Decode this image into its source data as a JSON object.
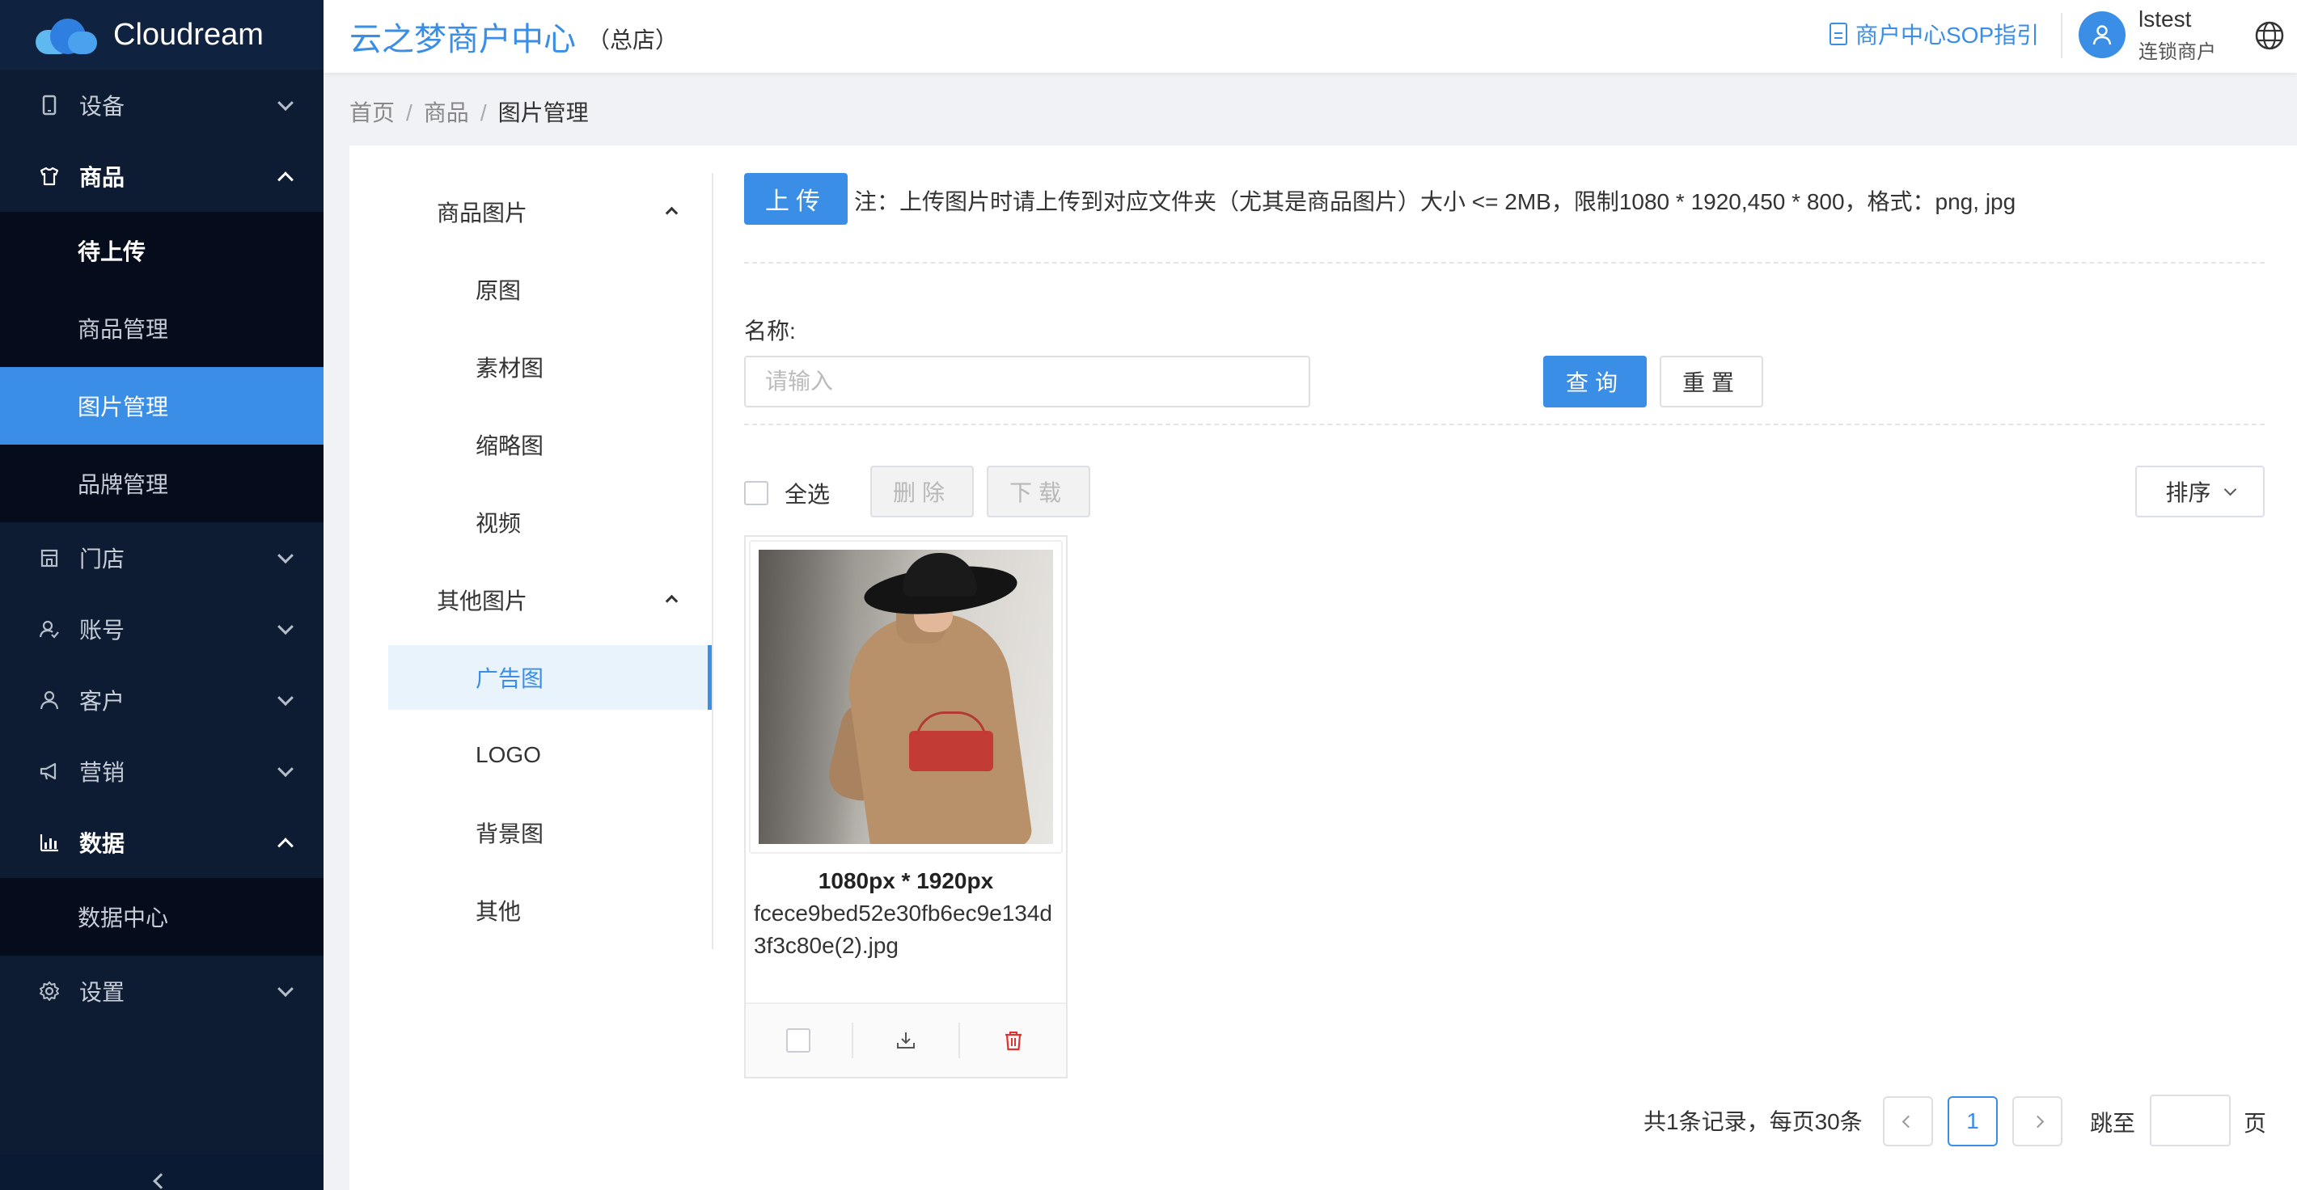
{
  "sidebar": {
    "brand": "Cloudream",
    "menu": {
      "devices": "设备",
      "goods": "商品",
      "goods_sub": [
        "待上传",
        "商品管理",
        "图片管理",
        "品牌管理"
      ],
      "stores": "门店",
      "accounts": "账号",
      "customers": "客户",
      "marketing": "营销",
      "data": "数据",
      "data_sub": [
        "数据中心"
      ],
      "settings": "设置"
    }
  },
  "header": {
    "title": "云之梦商户中心",
    "subtitle": "（总店）",
    "sop_link": "商户中心SOP指引",
    "user_name": "lstest",
    "user_role": "连锁商户"
  },
  "breadcrumb": [
    "首页",
    "商品",
    "图片管理"
  ],
  "folders": {
    "group1": "商品图片",
    "group1_items": [
      "原图",
      "素材图",
      "缩略图",
      "视频"
    ],
    "group2": "其他图片",
    "group2_items": [
      "广告图",
      "LOGO",
      "背景图",
      "其他"
    ]
  },
  "toolbar": {
    "upload": "上传",
    "note": "注：上传图片时请上传到对应文件夹（尤其是商品图片）大小 <= 2MB，限制1080 * 1920,450 * 800，格式：png, jpg"
  },
  "search": {
    "name_label": "名称:",
    "placeholder": "请输入",
    "query": "查询",
    "reset": "重置"
  },
  "actions": {
    "select_all": "全选",
    "delete": "删除",
    "download": "下载",
    "sort": "排序"
  },
  "images": [
    {
      "size": "1080px * 1920px",
      "name": "fcece9bed52e30fb6ec9e134d3f3c80e(2).jpg"
    }
  ],
  "pagination": {
    "total": "共1条记录，每页30条",
    "current": "1",
    "jump_label": "跳至",
    "page_unit": "页"
  },
  "colors": {
    "accent": "#3a8ee6",
    "sidebar_bg": "#0d1b33",
    "delete_red": "#e0332f"
  },
  "icons": [
    "device-icon",
    "goods-icon",
    "store-icon",
    "account-icon",
    "customer-icon",
    "marketing-icon",
    "data-icon",
    "settings-icon",
    "document-icon",
    "user-icon",
    "globe-icon",
    "download-icon",
    "trash-icon"
  ]
}
